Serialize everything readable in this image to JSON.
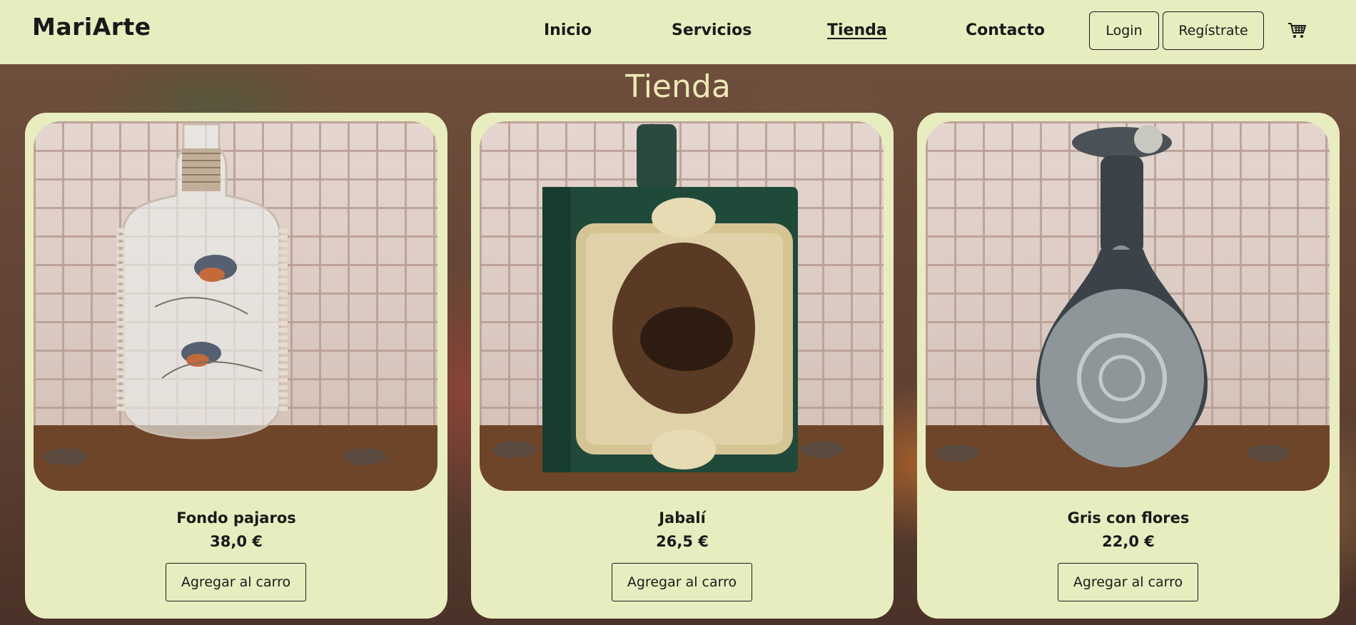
{
  "brand": "MariArte",
  "nav": {
    "items": [
      {
        "label": "Inicio",
        "active": false
      },
      {
        "label": "Servicios",
        "active": false
      },
      {
        "label": "Tienda",
        "active": true
      },
      {
        "label": "Contacto",
        "active": false
      }
    ],
    "login_label": "Login",
    "register_label": "Regístrate",
    "cart_icon": "shopping-cart-icon"
  },
  "page": {
    "title": "Tienda"
  },
  "products": [
    {
      "name": "Fondo pajaros",
      "price": "38,0 €",
      "button_label": "Agregar al carro"
    },
    {
      "name": "Jabalí",
      "price": "26,5 €",
      "button_label": "Agregar al carro"
    },
    {
      "name": "Gris con flores",
      "price": "22,0 €",
      "button_label": "Agregar al carro"
    }
  ],
  "colors": {
    "header_bg": "#e8edbf",
    "card_bg": "#e8edbf",
    "title_color": "#ece9b5",
    "text": "#1a1a1a"
  }
}
